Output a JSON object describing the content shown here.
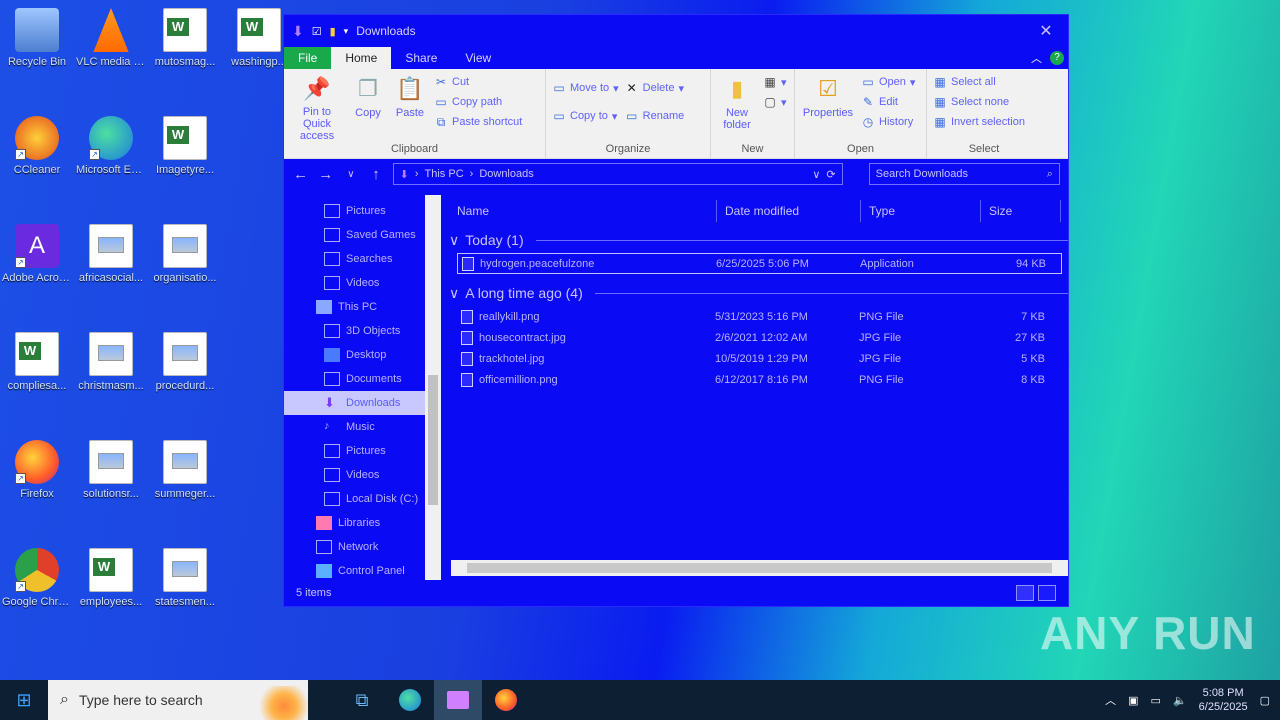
{
  "desktop": {
    "icons": [
      {
        "label": "Recycle Bin"
      },
      {
        "label": "VLC media player"
      },
      {
        "label": "mutosmag..."
      },
      {
        "label": "washingp..."
      },
      {
        "label": "CCleaner"
      },
      {
        "label": "Microsoft Edge"
      },
      {
        "label": "Imagetyre..."
      },
      {
        "label": "Adobe Acrobat"
      },
      {
        "label": "africasocial..."
      },
      {
        "label": "organisatio..."
      },
      {
        "label": "compliesa..."
      },
      {
        "label": "christmasm..."
      },
      {
        "label": "procedurd..."
      },
      {
        "label": "Firefox"
      },
      {
        "label": "solutionsr..."
      },
      {
        "label": "summeger..."
      },
      {
        "label": "Google Chrome"
      },
      {
        "label": "employees..."
      },
      {
        "label": "statesmen..."
      }
    ]
  },
  "window": {
    "title": "Downloads",
    "tabs": {
      "file": "File",
      "home": "Home",
      "share": "Share",
      "view": "View"
    },
    "ribbon": {
      "clipboard": {
        "label": "Clipboard",
        "pin": "Pin to Quick access",
        "copy": "Copy",
        "paste": "Paste",
        "cut": "Cut",
        "copy_path": "Copy path",
        "paste_shortcut": "Paste shortcut"
      },
      "organize": {
        "label": "Organize",
        "move_to": "Move to",
        "copy_to": "Copy to",
        "delete": "Delete",
        "rename": "Rename"
      },
      "new": {
        "label": "New",
        "new_folder": "New folder"
      },
      "open": {
        "label": "Open",
        "properties": "Properties",
        "open": "Open",
        "edit": "Edit",
        "history": "History"
      },
      "select": {
        "label": "Select",
        "select_all": "Select all",
        "select_none": "Select none",
        "invert": "Invert selection"
      }
    },
    "address": {
      "path_root": "This PC",
      "path_current": "Downloads",
      "search_placeholder": "Search Downloads"
    },
    "nav": [
      {
        "label": "Pictures"
      },
      {
        "label": "Saved Games"
      },
      {
        "label": "Searches"
      },
      {
        "label": "Videos"
      },
      {
        "label": "This PC"
      },
      {
        "label": "3D Objects"
      },
      {
        "label": "Desktop"
      },
      {
        "label": "Documents"
      },
      {
        "label": "Downloads"
      },
      {
        "label": "Music"
      },
      {
        "label": "Pictures"
      },
      {
        "label": "Videos"
      },
      {
        "label": "Local Disk (C:)"
      },
      {
        "label": "Libraries"
      },
      {
        "label": "Network"
      },
      {
        "label": "Control Panel"
      }
    ],
    "columns": {
      "name": "Name",
      "date": "Date modified",
      "type": "Type",
      "size": "Size"
    },
    "groups": [
      {
        "header": "Today (1)",
        "files": [
          {
            "name": "hydrogen.peacefulzone",
            "date": "6/25/2025 5:06 PM",
            "type": "Application",
            "size": "94 KB"
          }
        ]
      },
      {
        "header": "A long time ago (4)",
        "files": [
          {
            "name": "reallykill.png",
            "date": "5/31/2023 5:16 PM",
            "type": "PNG File",
            "size": "7 KB"
          },
          {
            "name": "housecontract.jpg",
            "date": "2/6/2021 12:02 AM",
            "type": "JPG File",
            "size": "27 KB"
          },
          {
            "name": "trackhotel.jpg",
            "date": "10/5/2019 1:29 PM",
            "type": "JPG File",
            "size": "5 KB"
          },
          {
            "name": "officemillion.png",
            "date": "6/12/2017 8:16 PM",
            "type": "PNG File",
            "size": "8 KB"
          }
        ]
      }
    ],
    "status": "5 items"
  },
  "taskbar": {
    "search_placeholder": "Type here to search",
    "time": "5:08 PM",
    "date": "6/25/2025"
  },
  "watermark": "ANY RUN"
}
